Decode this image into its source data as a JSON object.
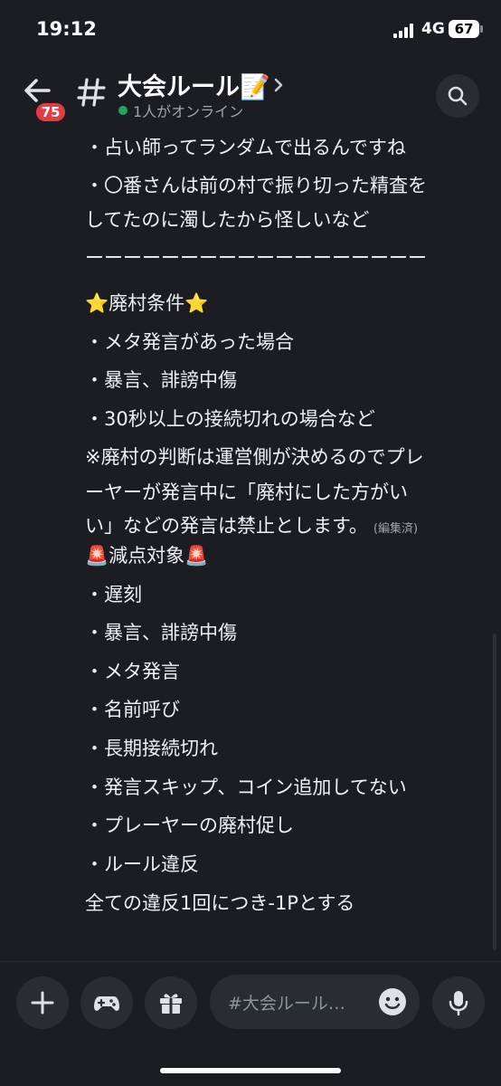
{
  "status": {
    "time": "19:12",
    "network": "4G",
    "battery": "67"
  },
  "header": {
    "unread_count": "75",
    "channel_name": "大会ルール📝",
    "online_text": "1人がオンライン"
  },
  "messages": [
    {
      "text": "・占い師ってランダムで出るんですね"
    },
    {
      "text": "・〇番さんは前の村で振り切った精査を"
    },
    {
      "text": "してたのに濁したから怪しいなど"
    },
    {
      "text": "ーーーーーーーーーーーーーーーーーー"
    },
    {
      "text": "⭐廃村条件⭐"
    },
    {
      "text": "・メタ発言があった場合"
    },
    {
      "text": "・暴言、誹謗中傷"
    },
    {
      "text": "・30秒以上の接続切れの場合など"
    },
    {
      "text": "※廃村の判断は運営側が決めるのでプレ"
    },
    {
      "text": "ーヤーが発言中に「廃村にした方がい"
    },
    {
      "text": "い」などの発言は禁止とします。",
      "edited": "(編集済)"
    },
    {
      "text": "🚨減点対象🚨"
    },
    {
      "text": "・遅刻"
    },
    {
      "text": "・暴言、誹謗中傷"
    },
    {
      "text": "・メタ発言"
    },
    {
      "text": "・名前呼び"
    },
    {
      "text": "・長期接続切れ"
    },
    {
      "text": "・発言スキップ、コイン追加してない"
    },
    {
      "text": "・プレーヤーの廃村促し"
    },
    {
      "text": "・ルール違反"
    },
    {
      "text": "全ての違反1回につき-1Pとする"
    }
  ],
  "composer": {
    "placeholder": "#大会ルール…"
  },
  "icons": {
    "back": "arrow-left-icon",
    "channel": "hash-icon",
    "search": "search-icon",
    "add": "plus-icon",
    "apps": "gamepad-icon",
    "gift": "gift-icon",
    "emoji": "smile-icon",
    "voice": "microphone-icon"
  },
  "colors": {
    "background": "#1c1d22",
    "badge": "#e53b45",
    "online": "#23a55a",
    "button": "#2a2c33"
  }
}
